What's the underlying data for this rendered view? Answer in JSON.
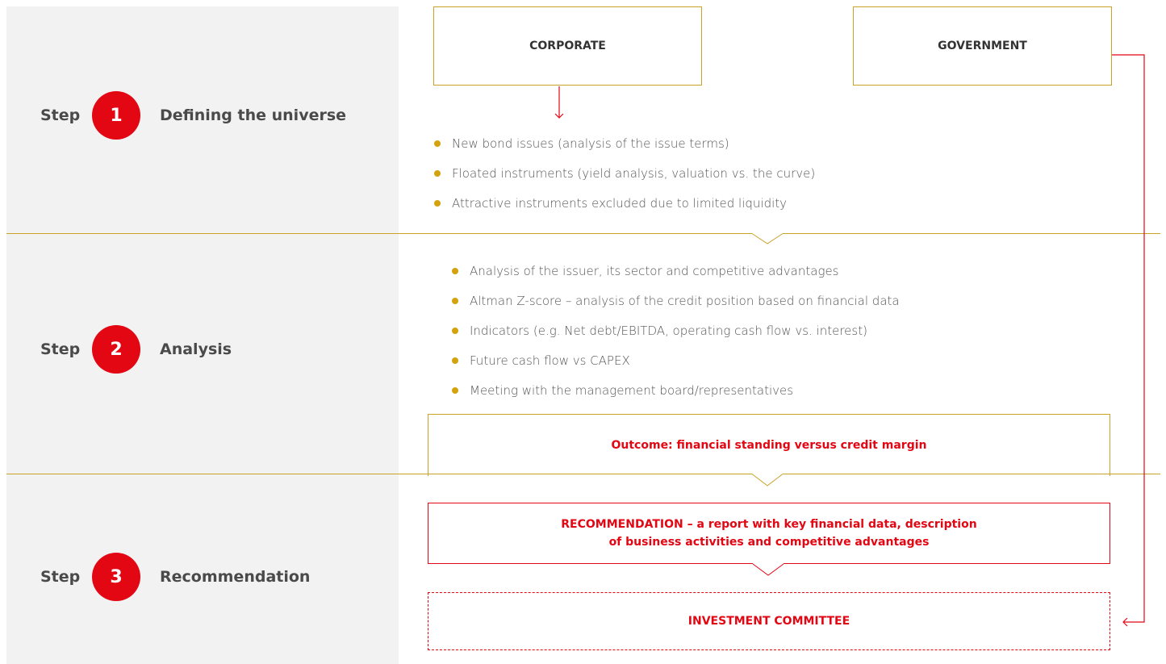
{
  "steps": [
    {
      "word": "Step",
      "num": "1",
      "title": "Defining the universe"
    },
    {
      "word": "Step",
      "num": "2",
      "title": "Analysis"
    },
    {
      "word": "Step",
      "num": "3",
      "title": "Recommendation"
    }
  ],
  "boxes": {
    "corporate": "CORPORATE",
    "government": "GOVERNMENT",
    "outcome": "Outcome: financial standing versus credit margin",
    "recommendation_line1": "RECOMMENDATION – a report with key financial data, description",
    "recommendation_line2": "of business activities and competitive advantages",
    "committee": "INVESTMENT COMMITTEE"
  },
  "step1_bullets": [
    "New bond issues (analysis of the issue terms)",
    "Floated instruments (yield analysis, valuation vs. the curve)",
    "Attractive instruments excluded due to limited liquidity"
  ],
  "step2_bullets": [
    "Analysis of the issuer, its sector and competitive advantages",
    "Altman Z-score – analysis of the credit position based on financial data",
    "Indicators (e.g. Net debt/EBITDA, operating cash flow vs. interest)",
    "Future cash flow vs CAPEX",
    "Meeting with the management board/representatives"
  ],
  "colors": {
    "accent_red": "#e30613",
    "gold": "#c9a227",
    "bullet": "#d4a20c",
    "panel": "#f2f2f2"
  }
}
